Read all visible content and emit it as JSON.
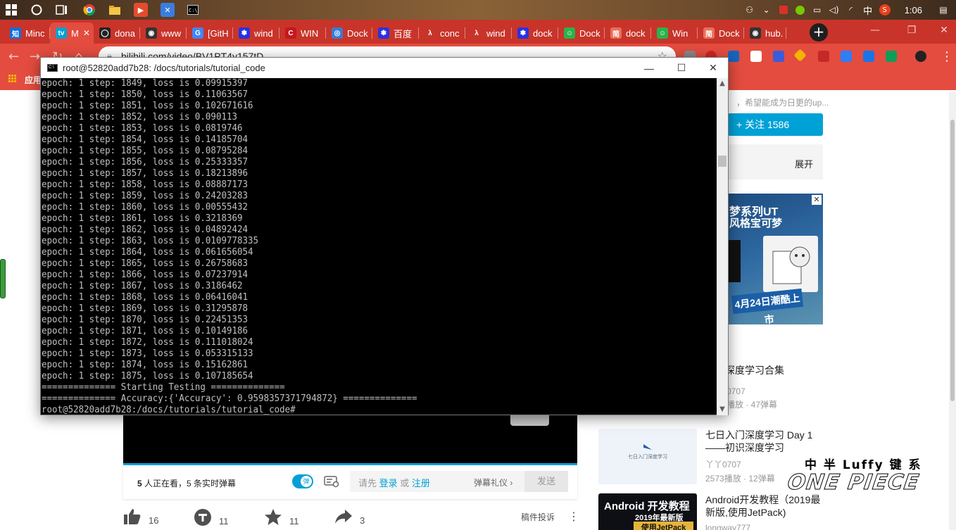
{
  "taskbar": {
    "clock": "1:06",
    "ime": "中",
    "icons": [
      "windows-start-icon",
      "cortana-icon",
      "task-view-icon",
      "chrome-icon",
      "file-explorer-icon",
      "app-icon",
      "app-icon-2",
      "terminal-icon"
    ]
  },
  "browser": {
    "tabs": [
      {
        "label": "Minc",
        "fav": "知",
        "color": "#0e6fe0"
      },
      {
        "label": "M",
        "fav": "tv",
        "color": "#00a1d6",
        "active": true
      },
      {
        "label": "dona",
        "fav": "◯",
        "color": "#222"
      },
      {
        "label": "www",
        "fav": "◉",
        "color": "#333"
      },
      {
        "label": "[GitH",
        "fav": "G",
        "color": "#4285f4"
      },
      {
        "label": "wind",
        "fav": "✽",
        "color": "#2932e1"
      },
      {
        "label": "WIN",
        "fav": "C",
        "color": "#c8161e"
      },
      {
        "label": "Dock",
        "fav": "◎",
        "color": "#3a7bd5"
      },
      {
        "label": "百度",
        "fav": "✽",
        "color": "#2932e1"
      },
      {
        "label": "conc",
        "fav": "λ",
        "color": "#c8342a"
      },
      {
        "label": "wind",
        "fav": "λ",
        "color": "#c8342a"
      },
      {
        "label": "dock",
        "fav": "✽",
        "color": "#2932e1"
      },
      {
        "label": "Dock",
        "fav": "☺",
        "color": "#2bb24c"
      },
      {
        "label": "dock",
        "fav": "简",
        "color": "#ea6f5a"
      },
      {
        "label": "Win",
        "fav": "☺",
        "color": "#2bb24c"
      },
      {
        "label": "Dock",
        "fav": "简",
        "color": "#ea6f5a"
      },
      {
        "label": "hub.",
        "fav": "◉",
        "color": "#333"
      }
    ],
    "url": "bilibili.com/video/BV1PT4y157tD",
    "bookmarks_label": "应用"
  },
  "terminal": {
    "title": "root@52820add7b28: /docs/tutorials/tutorial_code",
    "lines": [
      "epoch: 1 step: 1849, loss is 0.09915397",
      "epoch: 1 step: 1850, loss is 0.11063567",
      "epoch: 1 step: 1851, loss is 0.102671616",
      "epoch: 1 step: 1852, loss is 0.090113",
      "epoch: 1 step: 1853, loss is 0.0819746",
      "epoch: 1 step: 1854, loss is 0.14185704",
      "epoch: 1 step: 1855, loss is 0.08795284",
      "epoch: 1 step: 1856, loss is 0.25333357",
      "epoch: 1 step: 1857, loss is 0.18213896",
      "epoch: 1 step: 1858, loss is 0.08887173",
      "epoch: 1 step: 1859, loss is 0.24203283",
      "epoch: 1 step: 1860, loss is 0.00555432",
      "epoch: 1 step: 1861, loss is 0.3218369",
      "epoch: 1 step: 1862, loss is 0.04892424",
      "epoch: 1 step: 1863, loss is 0.0109778335",
      "epoch: 1 step: 1864, loss is 0.061656054",
      "epoch: 1 step: 1865, loss is 0.26758683",
      "epoch: 1 step: 1866, loss is 0.07237914",
      "epoch: 1 step: 1867, loss is 0.3186462",
      "epoch: 1 step: 1868, loss is 0.06416041",
      "epoch: 1 step: 1869, loss is 0.31295878",
      "epoch: 1 step: 1870, loss is 0.22451353",
      "epoch: 1 step: 1871, loss is 0.10149186",
      "epoch: 1 step: 1872, loss is 0.111018024",
      "epoch: 1 step: 1873, loss is 0.053315133",
      "epoch: 1 step: 1874, loss is 0.15162861",
      "epoch: 1 step: 1875, loss is 0.107185654",
      "============== Starting Testing ==============",
      "============== Accuracy:{'Accuracy': 0.9598357371794872} ==============",
      "root@52820add7b28:/docs/tutorials/tutorial_code#"
    ]
  },
  "page": {
    "up_desc": "，希望能成为日更的up...",
    "follow_label": "+  关注 1586",
    "expand_label": "展开",
    "ad": {
      "title1": "梦系列UT",
      "title2": "风格宝可梦",
      "banner": "4月24日潮酷上市"
    },
    "related": [
      {
        "title": "入门深度学习合集",
        "up": "0707",
        "meta": "播放 · 47弹幕"
      },
      {
        "title": "七日入门深度学习 Day 1——初识深度学习",
        "up": "丫丫0707",
        "meta": "2573播放 · 12弹幕"
      },
      {
        "title": "Android开发教程（2019最新版,使用JetPack)",
        "up": "longway777",
        "meta": ""
      }
    ],
    "thumb_text": "七日入门深度学习",
    "thumb3": {
      "line1": "Android 开发教程",
      "line2": "2019年最新版",
      "line3": "使用JetPack"
    },
    "watching": {
      "count": "5",
      "text": " 人正在看，",
      "danmaku_count": "5",
      "danmaku_text": " 条实时弹幕"
    },
    "danmaku_toggle": "弹",
    "input_prefix": "请先 ",
    "login": "登录",
    "or": " 或 ",
    "register": "注册",
    "etiquette": "弹幕礼仪 ›",
    "send": "发送",
    "actions": {
      "like": "16",
      "coin": "11",
      "fav": "11",
      "share": "3",
      "report": "稿件投诉"
    },
    "watermark": {
      "top": "中 半 Luffy 键 系",
      "main": "ONE PIECE"
    }
  }
}
